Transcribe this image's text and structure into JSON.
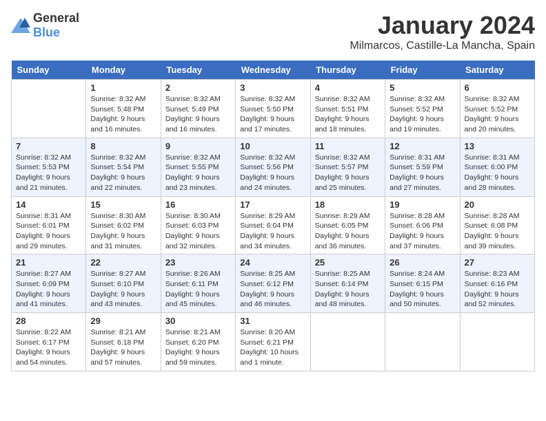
{
  "header": {
    "logo_general": "General",
    "logo_blue": "Blue",
    "month_year": "January 2024",
    "location": "Milmarcos, Castille-La Mancha, Spain"
  },
  "weekdays": [
    "Sunday",
    "Monday",
    "Tuesday",
    "Wednesday",
    "Thursday",
    "Friday",
    "Saturday"
  ],
  "weeks": [
    [
      {
        "day": "",
        "info": ""
      },
      {
        "day": "1",
        "info": "Sunrise: 8:32 AM\nSunset: 5:48 PM\nDaylight: 9 hours\nand 16 minutes."
      },
      {
        "day": "2",
        "info": "Sunrise: 8:32 AM\nSunset: 5:49 PM\nDaylight: 9 hours\nand 16 minutes."
      },
      {
        "day": "3",
        "info": "Sunrise: 8:32 AM\nSunset: 5:50 PM\nDaylight: 9 hours\nand 17 minutes."
      },
      {
        "day": "4",
        "info": "Sunrise: 8:32 AM\nSunset: 5:51 PM\nDaylight: 9 hours\nand 18 minutes."
      },
      {
        "day": "5",
        "info": "Sunrise: 8:32 AM\nSunset: 5:52 PM\nDaylight: 9 hours\nand 19 minutes."
      },
      {
        "day": "6",
        "info": "Sunrise: 8:32 AM\nSunset: 5:52 PM\nDaylight: 9 hours\nand 20 minutes."
      }
    ],
    [
      {
        "day": "7",
        "info": "Sunrise: 8:32 AM\nSunset: 5:53 PM\nDaylight: 9 hours\nand 21 minutes."
      },
      {
        "day": "8",
        "info": "Sunrise: 8:32 AM\nSunset: 5:54 PM\nDaylight: 9 hours\nand 22 minutes."
      },
      {
        "day": "9",
        "info": "Sunrise: 8:32 AM\nSunset: 5:55 PM\nDaylight: 9 hours\nand 23 minutes."
      },
      {
        "day": "10",
        "info": "Sunrise: 8:32 AM\nSunset: 5:56 PM\nDaylight: 9 hours\nand 24 minutes."
      },
      {
        "day": "11",
        "info": "Sunrise: 8:32 AM\nSunset: 5:57 PM\nDaylight: 9 hours\nand 25 minutes."
      },
      {
        "day": "12",
        "info": "Sunrise: 8:31 AM\nSunset: 5:59 PM\nDaylight: 9 hours\nand 27 minutes."
      },
      {
        "day": "13",
        "info": "Sunrise: 8:31 AM\nSunset: 6:00 PM\nDaylight: 9 hours\nand 28 minutes."
      }
    ],
    [
      {
        "day": "14",
        "info": "Sunrise: 8:31 AM\nSunset: 6:01 PM\nDaylight: 9 hours\nand 29 minutes."
      },
      {
        "day": "15",
        "info": "Sunrise: 8:30 AM\nSunset: 6:02 PM\nDaylight: 9 hours\nand 31 minutes."
      },
      {
        "day": "16",
        "info": "Sunrise: 8:30 AM\nSunset: 6:03 PM\nDaylight: 9 hours\nand 32 minutes."
      },
      {
        "day": "17",
        "info": "Sunrise: 8:29 AM\nSunset: 6:04 PM\nDaylight: 9 hours\nand 34 minutes."
      },
      {
        "day": "18",
        "info": "Sunrise: 8:29 AM\nSunset: 6:05 PM\nDaylight: 9 hours\nand 36 minutes."
      },
      {
        "day": "19",
        "info": "Sunrise: 8:28 AM\nSunset: 6:06 PM\nDaylight: 9 hours\nand 37 minutes."
      },
      {
        "day": "20",
        "info": "Sunrise: 8:28 AM\nSunset: 6:08 PM\nDaylight: 9 hours\nand 39 minutes."
      }
    ],
    [
      {
        "day": "21",
        "info": "Sunrise: 8:27 AM\nSunset: 6:09 PM\nDaylight: 9 hours\nand 41 minutes."
      },
      {
        "day": "22",
        "info": "Sunrise: 8:27 AM\nSunset: 6:10 PM\nDaylight: 9 hours\nand 43 minutes."
      },
      {
        "day": "23",
        "info": "Sunrise: 8:26 AM\nSunset: 6:11 PM\nDaylight: 9 hours\nand 45 minutes."
      },
      {
        "day": "24",
        "info": "Sunrise: 8:25 AM\nSunset: 6:12 PM\nDaylight: 9 hours\nand 46 minutes."
      },
      {
        "day": "25",
        "info": "Sunrise: 8:25 AM\nSunset: 6:14 PM\nDaylight: 9 hours\nand 48 minutes."
      },
      {
        "day": "26",
        "info": "Sunrise: 8:24 AM\nSunset: 6:15 PM\nDaylight: 9 hours\nand 50 minutes."
      },
      {
        "day": "27",
        "info": "Sunrise: 8:23 AM\nSunset: 6:16 PM\nDaylight: 9 hours\nand 52 minutes."
      }
    ],
    [
      {
        "day": "28",
        "info": "Sunrise: 8:22 AM\nSunset: 6:17 PM\nDaylight: 9 hours\nand 54 minutes."
      },
      {
        "day": "29",
        "info": "Sunrise: 8:21 AM\nSunset: 6:18 PM\nDaylight: 9 hours\nand 57 minutes."
      },
      {
        "day": "30",
        "info": "Sunrise: 8:21 AM\nSunset: 6:20 PM\nDaylight: 9 hours\nand 59 minutes."
      },
      {
        "day": "31",
        "info": "Sunrise: 8:20 AM\nSunset: 6:21 PM\nDaylight: 10 hours\nand 1 minute."
      },
      {
        "day": "",
        "info": ""
      },
      {
        "day": "",
        "info": ""
      },
      {
        "day": "",
        "info": ""
      }
    ]
  ]
}
